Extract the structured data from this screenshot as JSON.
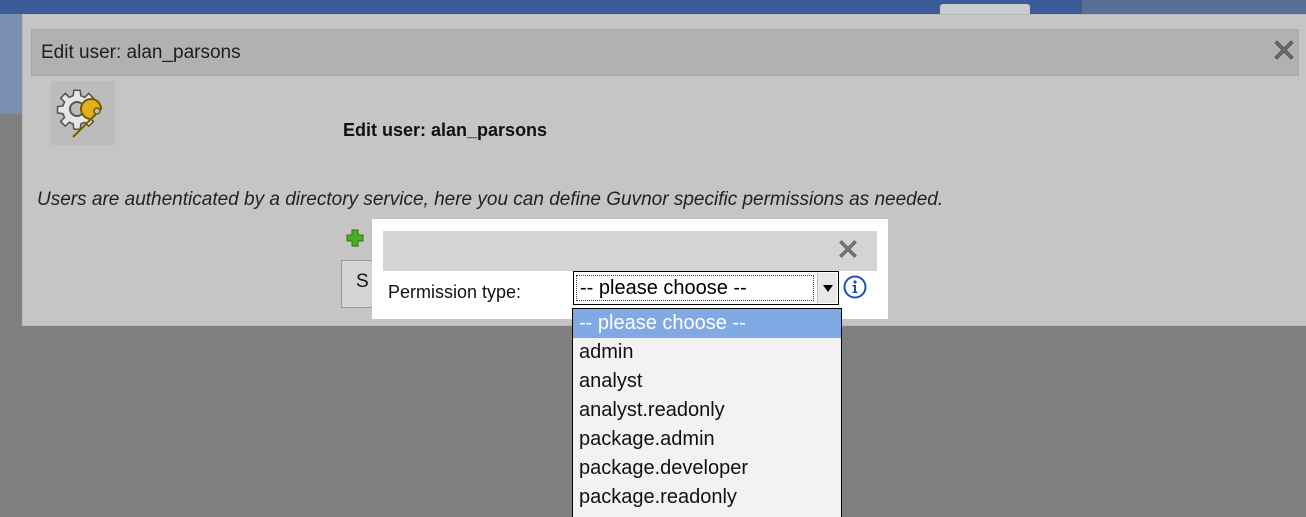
{
  "dialog": {
    "title": "Edit user: alan_parsons",
    "heading": "Edit user: alan_parsons",
    "description": "Users are authenticated by a directory service, here you can define Guvnor specific permissions as needed.",
    "save_button_label": "S",
    "close_icon": "close-x-icon",
    "header_icon": "gear-wrench-icon",
    "add_icon": "plus-icon"
  },
  "permission_popup": {
    "label": "Permission type:",
    "selected_value": "-- please choose --",
    "info_icon": "info-icon",
    "close_icon": "close-x-icon",
    "options": [
      "-- please choose --",
      "admin",
      "analyst",
      "analyst.readonly",
      "package.admin",
      "package.developer",
      "package.readonly"
    ],
    "highlighted_option_index": 0
  },
  "colors": {
    "dialog_bg": "#c5c5c5",
    "highlight": "#81a9e3",
    "backdrop": "#808080"
  }
}
